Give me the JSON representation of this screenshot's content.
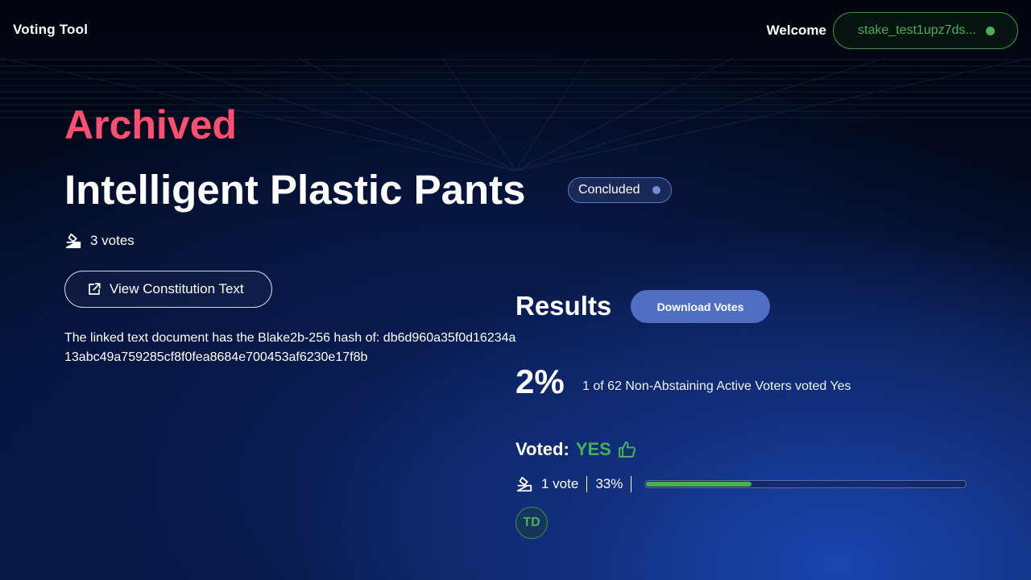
{
  "app": {
    "title": "Voting Tool"
  },
  "header": {
    "welcome_label": "Welcome",
    "wallet_address": "stake_test1upz7ds...",
    "wallet_status_color": "#4cae58"
  },
  "proposal": {
    "archived_label": "Archived",
    "title": "Intelligent Plastic Pants",
    "status": "Concluded",
    "votes_count": "3 votes",
    "constitution_button": "View Constitution Text",
    "hash_text": "The linked text document has the Blake2b-256 hash of: db6d960a35f0d16234a13abc49a759285cf8f0fea8684e700453af6230e17f8b"
  },
  "results": {
    "title": "Results",
    "download_button": "Download Votes",
    "percentage": "2%",
    "description": "1 of 62 Non-Abstaining Active Voters voted Yes",
    "voted_label": "Voted:",
    "voted_value": "YES",
    "vote_count": "1 vote",
    "vote_percentage": "33%",
    "vote_fraction": 0.33,
    "voters": [
      {
        "initials": "TD"
      }
    ]
  },
  "colors": {
    "accent_red": "#ff4f70",
    "accent_green": "#4cae58",
    "accent_blue": "#4e6fc4"
  },
  "icons": {
    "votes": "ballot-box-icon",
    "external": "external-link-icon",
    "thumb": "thumbs-up-icon"
  }
}
